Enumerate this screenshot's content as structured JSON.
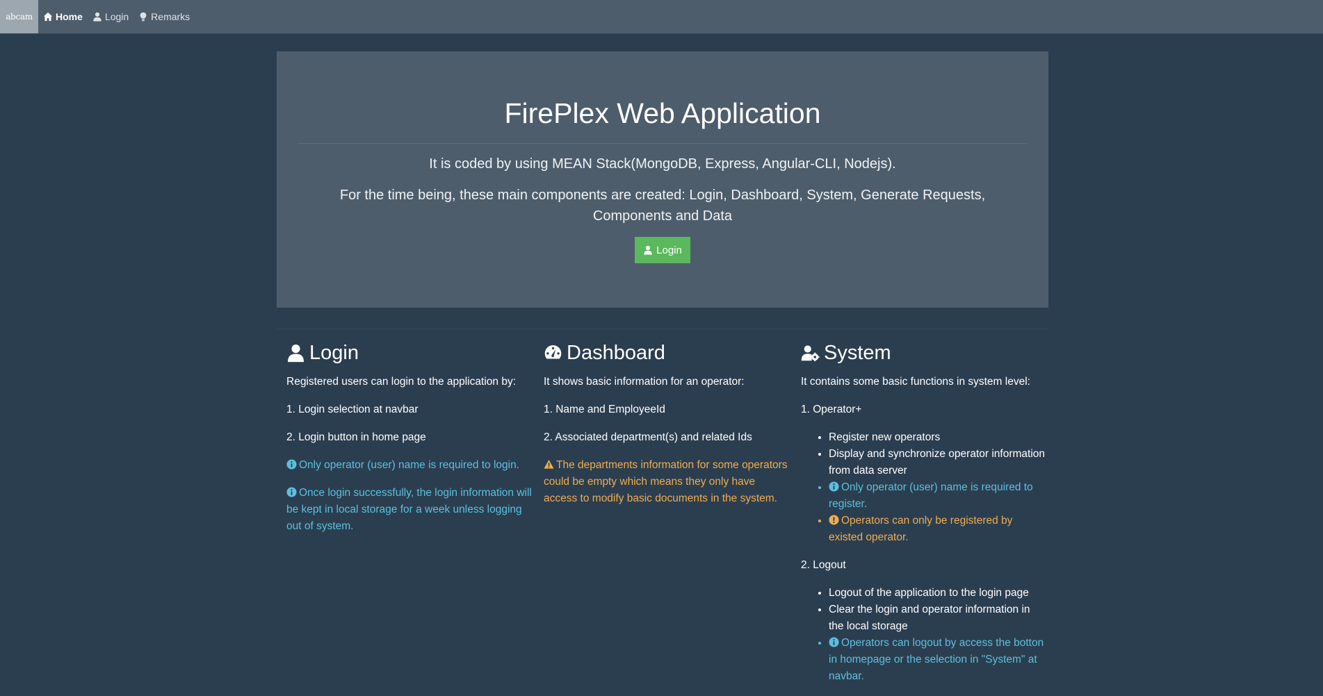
{
  "navbar": {
    "brand": "abcam",
    "items": [
      {
        "label": "Home",
        "icon": "home-icon",
        "active": true
      },
      {
        "label": "Login",
        "icon": "user-icon"
      },
      {
        "label": "Remarks",
        "icon": "lightbulb-icon"
      }
    ]
  },
  "hero": {
    "title": "FirePlex Web Application",
    "line1": "It is coded by using MEAN Stack(MongoDB, Express, Angular-CLI, Nodejs).",
    "line2": "For the time being, these main components are created: Login, Dashboard, System, Generate Requests, Components and Data",
    "button_label": "Login"
  },
  "colors": {
    "background": "#2b3e50",
    "panel": "#4e5d6c",
    "success": "#5cb85c",
    "info": "#5bc0de",
    "warning": "#f0ad4e"
  },
  "login_section": {
    "title": "Login",
    "icon": "user-icon",
    "intro": "Registered users can login to the application by:",
    "step1": "1. Login selection at navbar",
    "step2": "2. Login button in home page",
    "info1": "Only operator (user) name is required to login.",
    "info2": "Once login successfully, the login information will be kept in local storage for a week unless logging out of system."
  },
  "dashboard_section": {
    "title": "Dashboard",
    "icon": "gauge-icon",
    "intro": "It shows basic information for an operator:",
    "step1": "1. Name and EmployeeId",
    "step2": "2. Associated department(s) and related Ids",
    "warning": "The departments information for some operators could be empty which means they only have access to modify basic documents in the system."
  },
  "system_section": {
    "title": "System",
    "icon": "user-gear-icon",
    "intro": "It contains some basic functions in system level:",
    "operator_heading": "1. Operator+",
    "operator_items": [
      "Register new operators",
      "Display and synchronize operator information from data server"
    ],
    "operator_info": "Only operator (user) name is required to register.",
    "operator_warning": "Operators can only be registered by existed operator.",
    "logout_heading": "2. Logout",
    "logout_items": [
      "Logout of the application to the login page",
      "Clear the login and operator information in the local storage"
    ],
    "logout_info": "Operators can logout by access the botton in homepage or the selection in \"System\" at navbar."
  }
}
